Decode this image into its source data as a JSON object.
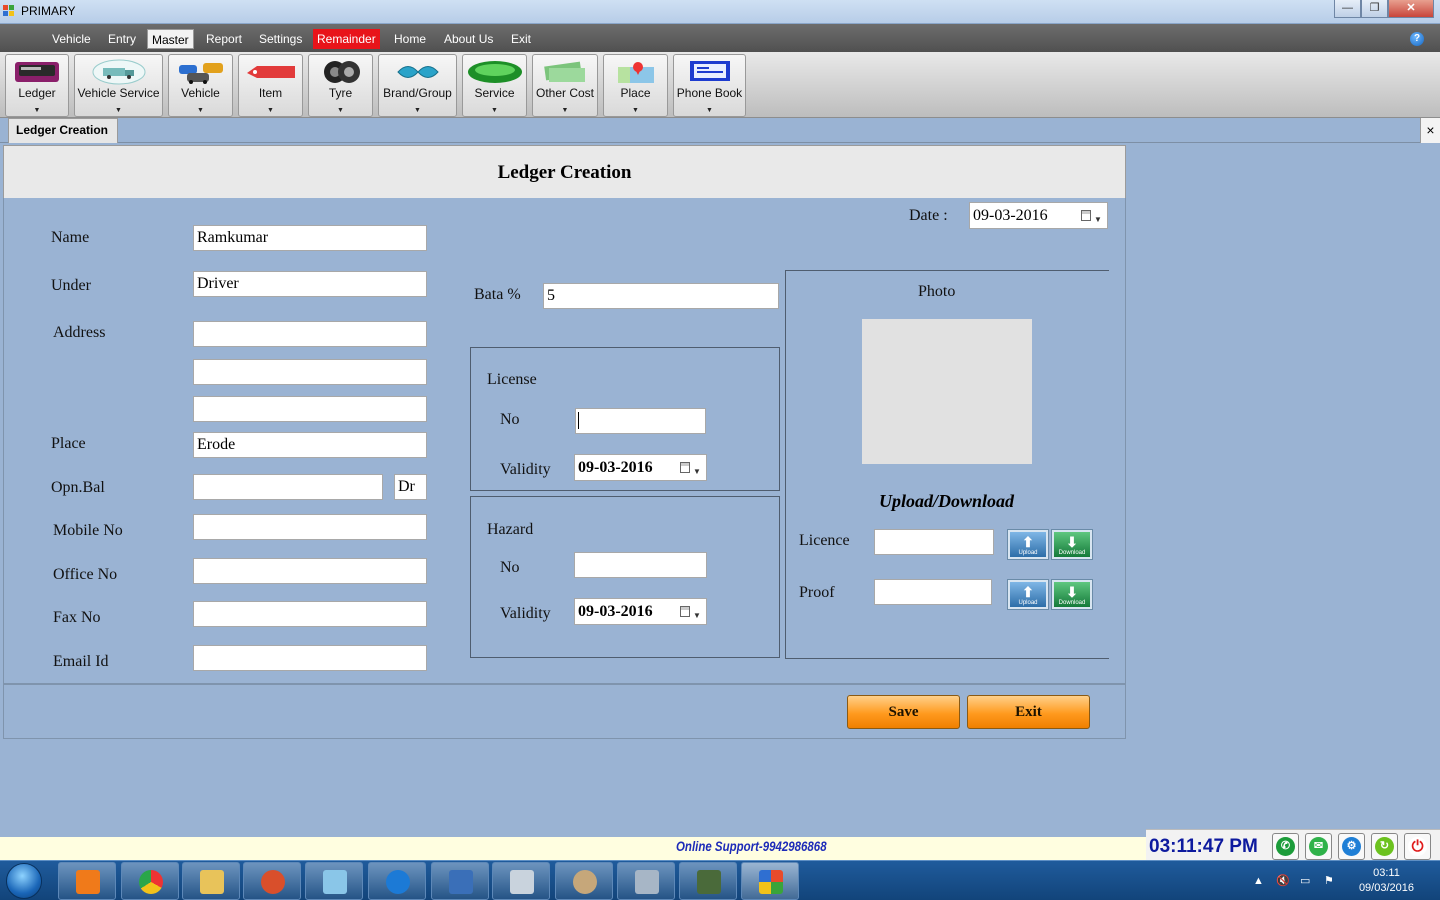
{
  "window": {
    "title": "PRIMARY"
  },
  "menu": {
    "items": [
      "Vehicle",
      "Entry",
      "Master",
      "Report",
      "Settings",
      "Remainder",
      "Home",
      "About Us",
      "Exit"
    ],
    "active": "Master"
  },
  "toolbar": {
    "items": [
      {
        "label": "Ledger",
        "icon": "ledger-icon"
      },
      {
        "label": "Vehicle Service",
        "icon": "truck-icon"
      },
      {
        "label": "Vehicle",
        "icon": "vehicles-icon"
      },
      {
        "label": "Item",
        "icon": "item-icon"
      },
      {
        "label": "Tyre",
        "icon": "tyre-icon"
      },
      {
        "label": "Brand/Group",
        "icon": "brand-icon"
      },
      {
        "label": "Service",
        "icon": "service-icon"
      },
      {
        "label": "Other Cost",
        "icon": "money-icon"
      },
      {
        "label": "Place",
        "icon": "map-icon"
      },
      {
        "label": "Phone Book",
        "icon": "phonebook-icon"
      }
    ]
  },
  "tab": {
    "label": "Ledger Creation",
    "close": "×"
  },
  "form": {
    "title": "Ledger Creation",
    "date_label": "Date :",
    "date_value": "09-03-2016",
    "name_label": "Name",
    "name_value": "Ramkumar",
    "under_label": "Under",
    "under_value": "Driver",
    "address_label": "Address",
    "address_lines": [
      "",
      "",
      ""
    ],
    "place_label": "Place",
    "place_value": "Erode",
    "opbal_label": "Opn.Bal",
    "opbal_value": "",
    "opbal_type": "Dr",
    "mobile_label": "Mobile No",
    "mobile_value": "",
    "office_label": "Office No",
    "office_value": "",
    "fax_label": "Fax No",
    "fax_value": "",
    "email_label": "Email Id",
    "email_value": "",
    "bata_label": "Bata %",
    "bata_value": "5",
    "license": {
      "title": "License",
      "no_label": "No",
      "no_value": "",
      "validity_label": "Validity",
      "validity_value": "09-03-2016"
    },
    "hazard": {
      "title": "Hazard",
      "no_label": "No",
      "no_value": "",
      "validity_label": "Validity",
      "validity_value": "09-03-2016"
    },
    "photo_label": "Photo",
    "upload_title": "Upload/Download",
    "licence_label": "Licence",
    "licence_value": "",
    "proof_label": "Proof",
    "proof_value": "",
    "upload_caption": "Upload",
    "download_caption": "Download",
    "save_label": "Save",
    "exit_label": "Exit"
  },
  "status": {
    "support": "Online Support-9942986868",
    "clock": "03:11:47 PM"
  },
  "taskbar": {
    "time": "03:11",
    "date": "09/03/2016"
  }
}
